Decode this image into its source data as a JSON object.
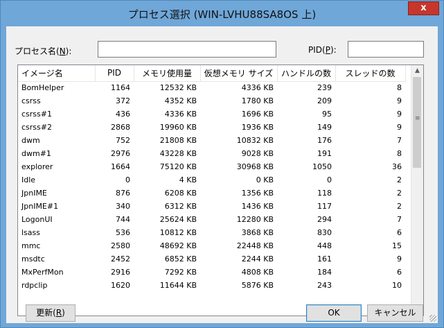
{
  "window": {
    "title": "プロセス選択 (WIN-LVHU88SA8OS 上)",
    "close_label": "x"
  },
  "filter": {
    "name_label": "プロセス名(",
    "name_key": "N",
    "name_suffix": "):",
    "name_value": "",
    "pid_label": "PID(",
    "pid_key": "P",
    "pid_suffix": "):",
    "pid_value": ""
  },
  "table": {
    "columns": [
      "イメージ名",
      "PID",
      "メモリ使用量",
      "仮想メモリ サイズ",
      "ハンドルの数",
      "スレッドの数"
    ],
    "rows": [
      [
        "BomHelper",
        "1164",
        "12532 KB",
        "4336 KB",
        "239",
        "8"
      ],
      [
        "csrss",
        "372",
        "4352 KB",
        "1780 KB",
        "209",
        "9"
      ],
      [
        "csrss#1",
        "436",
        "4336 KB",
        "1696 KB",
        "95",
        "9"
      ],
      [
        "csrss#2",
        "2868",
        "19960 KB",
        "1936 KB",
        "149",
        "9"
      ],
      [
        "dwm",
        "752",
        "21808 KB",
        "10832 KB",
        "176",
        "7"
      ],
      [
        "dwm#1",
        "2976",
        "43228 KB",
        "9028 KB",
        "191",
        "8"
      ],
      [
        "explorer",
        "1664",
        "75120 KB",
        "30968 KB",
        "1050",
        "36"
      ],
      [
        "Idle",
        "0",
        "4 KB",
        "0 KB",
        "0",
        "2"
      ],
      [
        "JpnIME",
        "876",
        "6208 KB",
        "1356 KB",
        "118",
        "2"
      ],
      [
        "JpnIME#1",
        "340",
        "6312 KB",
        "1436 KB",
        "117",
        "2"
      ],
      [
        "LogonUI",
        "744",
        "25624 KB",
        "12280 KB",
        "294",
        "7"
      ],
      [
        "lsass",
        "536",
        "10812 KB",
        "3868 KB",
        "830",
        "6"
      ],
      [
        "mmc",
        "2580",
        "48692 KB",
        "22448 KB",
        "448",
        "15"
      ],
      [
        "msdtc",
        "2452",
        "6852 KB",
        "2244 KB",
        "161",
        "9"
      ],
      [
        "MxPerfMon",
        "2916",
        "7292 KB",
        "4808 KB",
        "184",
        "6"
      ],
      [
        "rdpclip",
        "1620",
        "11644 KB",
        "5876 KB",
        "243",
        "10"
      ]
    ]
  },
  "buttons": {
    "refresh_label": "更新(",
    "refresh_key": "R",
    "refresh_suffix": ")",
    "ok_label": "OK",
    "cancel_label": "キャンセル"
  },
  "icons": {
    "scroll_up": "chevron-up-icon",
    "scroll_down": "chevron-down-icon",
    "grip": "scrollbar-grip-icon",
    "resize": "resize-grip-icon"
  }
}
